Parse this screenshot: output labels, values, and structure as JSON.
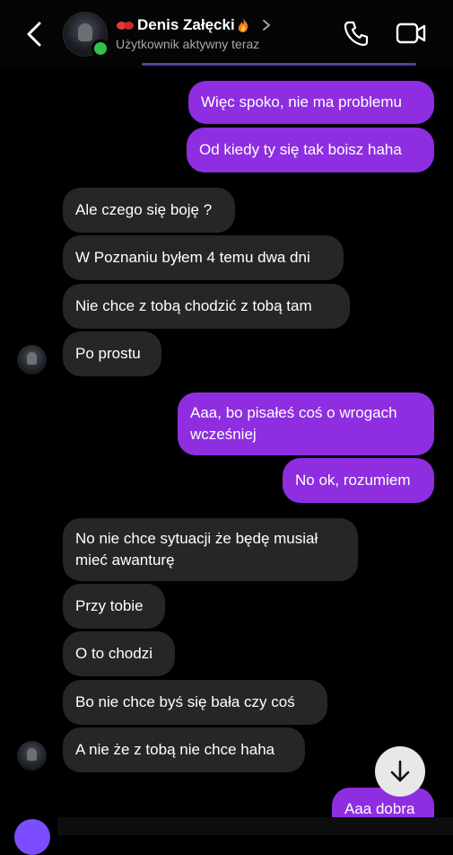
{
  "header": {
    "name": "Denis Załęcki",
    "status": "Użytkownik aktywny teraz",
    "icons": [
      "back-chevron-icon",
      "boxing-gloves-emoji",
      "fire-emoji",
      "chevron-right-icon",
      "phone-icon",
      "video-icon"
    ]
  },
  "messages": [
    {
      "side": "out",
      "text": "Więc spoko, nie ma problemu"
    },
    {
      "side": "out",
      "text": "Od kiedy ty się tak boisz haha"
    },
    {
      "side": "in",
      "text": "Ale czego się boję ?"
    },
    {
      "side": "in",
      "text": "W Poznaniu byłem 4 temu dwa dni"
    },
    {
      "side": "in",
      "text": "Nie chce z tobą chodzić z tobą tam"
    },
    {
      "side": "in",
      "text": "Po prostu"
    },
    {
      "side": "out",
      "line1": "Aaa, bo pisałeś coś o wrogach",
      "line2": "wcześniej"
    },
    {
      "side": "out",
      "text": "No ok, rozumiem"
    },
    {
      "side": "in",
      "line1": "No nie chce sytuacji że będę musiał",
      "line2": "mieć awanturę"
    },
    {
      "side": "in",
      "text": "Przy tobie"
    },
    {
      "side": "in",
      "text": "O to chodzi"
    },
    {
      "side": "in",
      "text": "Bo nie chce byś się bała czy coś"
    },
    {
      "side": "in",
      "text": "A nie że z tobą nie chce haha"
    },
    {
      "side": "out",
      "text": "Aaa dobra"
    }
  ],
  "colors": {
    "outgoing_bubble": "#8e2ee0",
    "incoming_bubble": "#262626",
    "online": "#31c24a",
    "background": "#000000"
  }
}
